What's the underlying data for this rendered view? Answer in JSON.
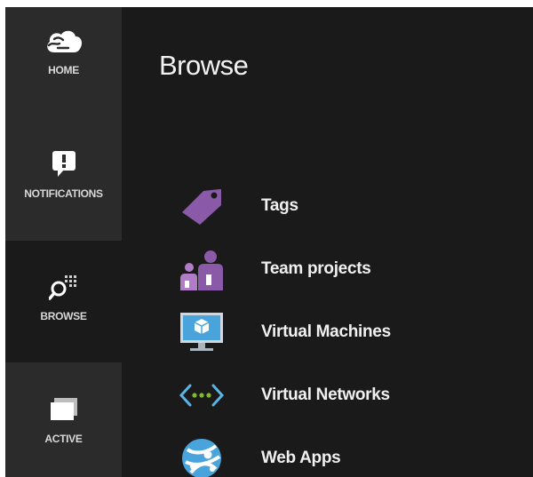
{
  "sidebar": {
    "items": [
      {
        "label": "HOME",
        "icon": "cloud-icon"
      },
      {
        "label": "NOTIFICATIONS",
        "icon": "notification-icon"
      },
      {
        "label": "BROWSE",
        "icon": "browse-search-icon",
        "selected": true
      },
      {
        "label": "ACTIVE",
        "icon": "windows-stack-icon"
      }
    ]
  },
  "main": {
    "title": "Browse",
    "items": [
      {
        "label": "Tags",
        "icon": "tag-icon",
        "color": "#8a5aa8"
      },
      {
        "label": "Team projects",
        "icon": "team-icon",
        "color": "#8a5aa8"
      },
      {
        "label": "Virtual Machines",
        "icon": "monitor-icon",
        "color": "#4aa4dc"
      },
      {
        "label": "Virtual Networks",
        "icon": "network-icon",
        "color": "#5ab4e4"
      },
      {
        "label": "Web Apps",
        "icon": "globe-icon",
        "color": "#4aa4dc"
      }
    ]
  },
  "colors": {
    "sidebar_bg": "#2b2b2b",
    "content_bg": "#1a1a1a",
    "text": "#f0f0f0",
    "accent_purple": "#8a5aa8",
    "accent_blue": "#4aa4dc"
  }
}
